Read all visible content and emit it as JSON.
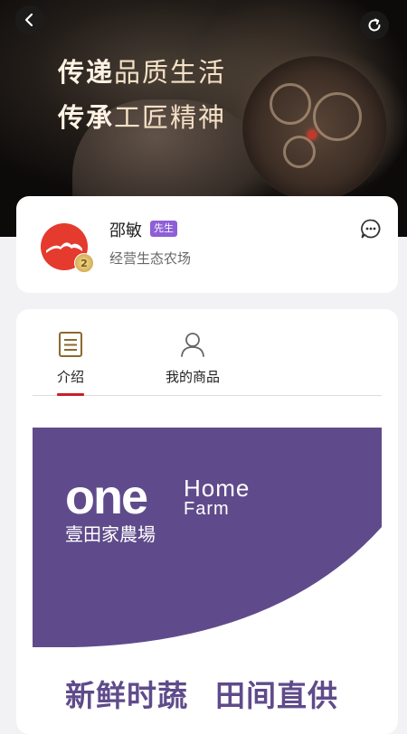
{
  "hero": {
    "slogan_line1_a": "传递",
    "slogan_line1_b": "品质生活",
    "slogan_line2_a": "传承",
    "slogan_line2_b": "工匠精神"
  },
  "nav": {
    "back_icon": "chevron-left-icon",
    "share_icon": "refresh-share-icon"
  },
  "profile": {
    "name": "邵敏",
    "badge": "先生",
    "description": "经营生态农场",
    "medal_text": "2",
    "chat_icon": "chat-bubble-icon"
  },
  "tabs": [
    {
      "label": "介绍",
      "icon": "document-icon",
      "active": true
    },
    {
      "label": "我的商品",
      "icon": "user-icon",
      "active": false
    }
  ],
  "banner": {
    "brand_en_one": "one",
    "brand_en_home": "Home",
    "brand_en_farm": "Farm",
    "brand_cn": "壹田家農場",
    "tagline_1": "新鲜时蔬",
    "tagline_2": "田间直供"
  },
  "colors": {
    "accent": "#c8202a",
    "brand_purple": "#5f4b8b",
    "badge_purple": "#8e5fd6"
  }
}
